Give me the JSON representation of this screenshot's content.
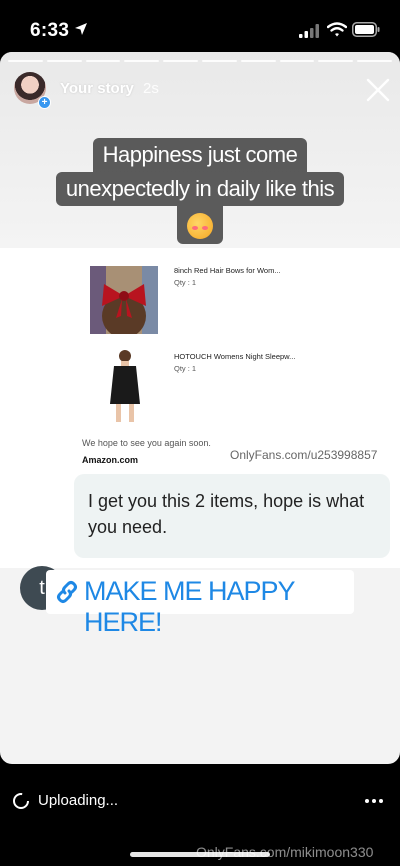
{
  "status": {
    "time": "6:33"
  },
  "story": {
    "user": "Your story",
    "time_ago": "2s",
    "caption_lines": [
      "Happiness just come",
      "unexpectedly in daily like this"
    ]
  },
  "receipt": {
    "items": [
      {
        "name": "8inch Red Hair Bows for Wom...",
        "qty": "Qty : 1"
      },
      {
        "name": "HOTOUCH Womens Night Sleepw...",
        "qty": "Qty : 1"
      }
    ],
    "hope_text": "We hope to see you again soon.",
    "store": "Amazon.com",
    "watermark": "OnlyFans.com/u253998857"
  },
  "message": {
    "text": "I get you this 2 items, hope is what you need.",
    "avatar_letter": "t"
  },
  "link_sticker": {
    "label": "MAKE ME HAPPY HERE!",
    "icon": "link-icon"
  },
  "bottom": {
    "upload_label": "Uploading...",
    "watermark": "OnlyFans.com/mikimoon330"
  },
  "colors": {
    "link": "#1e88e5",
    "badge": "#3897f0"
  }
}
